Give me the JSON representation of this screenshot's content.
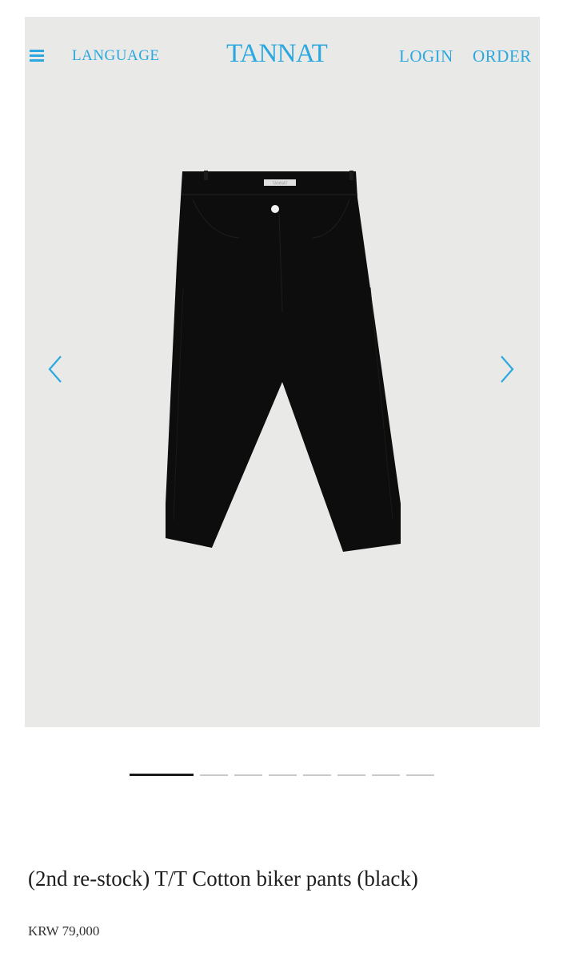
{
  "header": {
    "menu_icon": "hamburger-menu-icon",
    "language_label": "LANGUAGE",
    "brand": "TANNAT",
    "login_label": "LOGIN",
    "order_label": "ORDER"
  },
  "gallery": {
    "prev_icon": "chevron-left-icon",
    "next_icon": "chevron-right-icon",
    "slide_count": 8,
    "active_slide": 1,
    "garment_tag_text": "TANNAT"
  },
  "product": {
    "title": "(2nd re-stock) T/T Cotton biker pants (black)",
    "price": "KRW 79,000"
  },
  "colors": {
    "accent": "#2aa8df",
    "hero_background": "#e9e9e7",
    "garment": "#0d0d0d",
    "indicator_active": "#1a1a1a",
    "indicator_inactive": "#c8c8c8"
  }
}
